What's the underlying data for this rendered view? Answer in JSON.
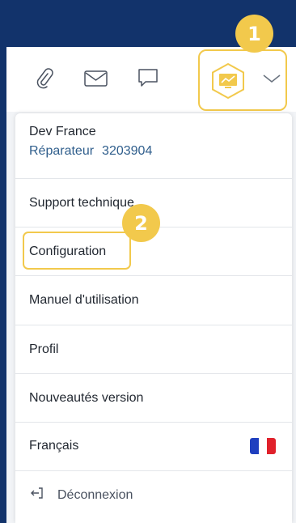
{
  "toolbar": {
    "icons": [
      "paperclip-icon",
      "mail-icon",
      "chat-icon"
    ],
    "avatar_icon": "monitor-chart-icon",
    "dropdown_icon": "chevron-down-icon"
  },
  "callouts": {
    "step1": "1",
    "step2": "2"
  },
  "user": {
    "name": "Dev France",
    "role": "Réparateur",
    "id": "3203904"
  },
  "menu": {
    "support": "Support technique",
    "configuration": "Configuration",
    "manual": "Manuel d'utilisation",
    "profile": "Profil",
    "news": "Nouveautés version",
    "language": "Français",
    "logout": "Déconnexion"
  },
  "colors": {
    "background": "#12336b",
    "highlight": "#f2c94c",
    "role_text": "#2f5e8c",
    "flag_blue": "#1f3fbf",
    "flag_white": "#ffffff",
    "flag_red": "#e0212b"
  }
}
